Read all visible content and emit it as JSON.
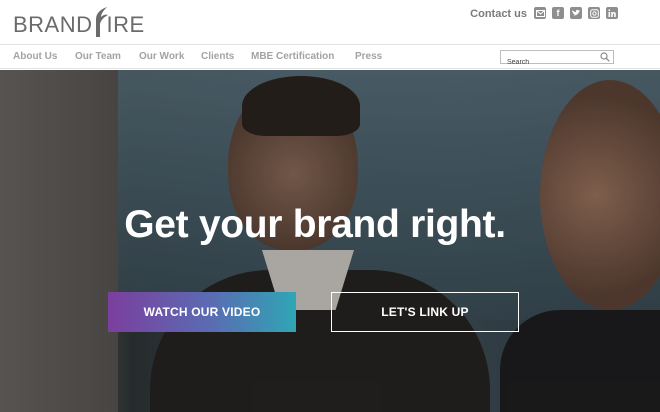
{
  "brand": {
    "logo_text_left": "BRAND",
    "logo_text_right": "IRE",
    "text_color": "#6b6b6b"
  },
  "header": {
    "contact_label": "Contact us",
    "social_icons": [
      "email-icon",
      "facebook-icon",
      "twitter-icon",
      "instagram-icon",
      "linkedin-icon"
    ]
  },
  "nav": {
    "items": [
      "About Us",
      "Our Team",
      "Our Work",
      "Clients",
      "MBE Certification",
      "Press"
    ],
    "search_placeholder": "Search",
    "search_value": ""
  },
  "hero": {
    "headline": "Get your brand right.",
    "primary_button": "WATCH OUR VIDEO",
    "secondary_button": "LET'S LINK UP",
    "primary_gradient": [
      "#7b3f9e",
      "#2fa6b4"
    ]
  }
}
